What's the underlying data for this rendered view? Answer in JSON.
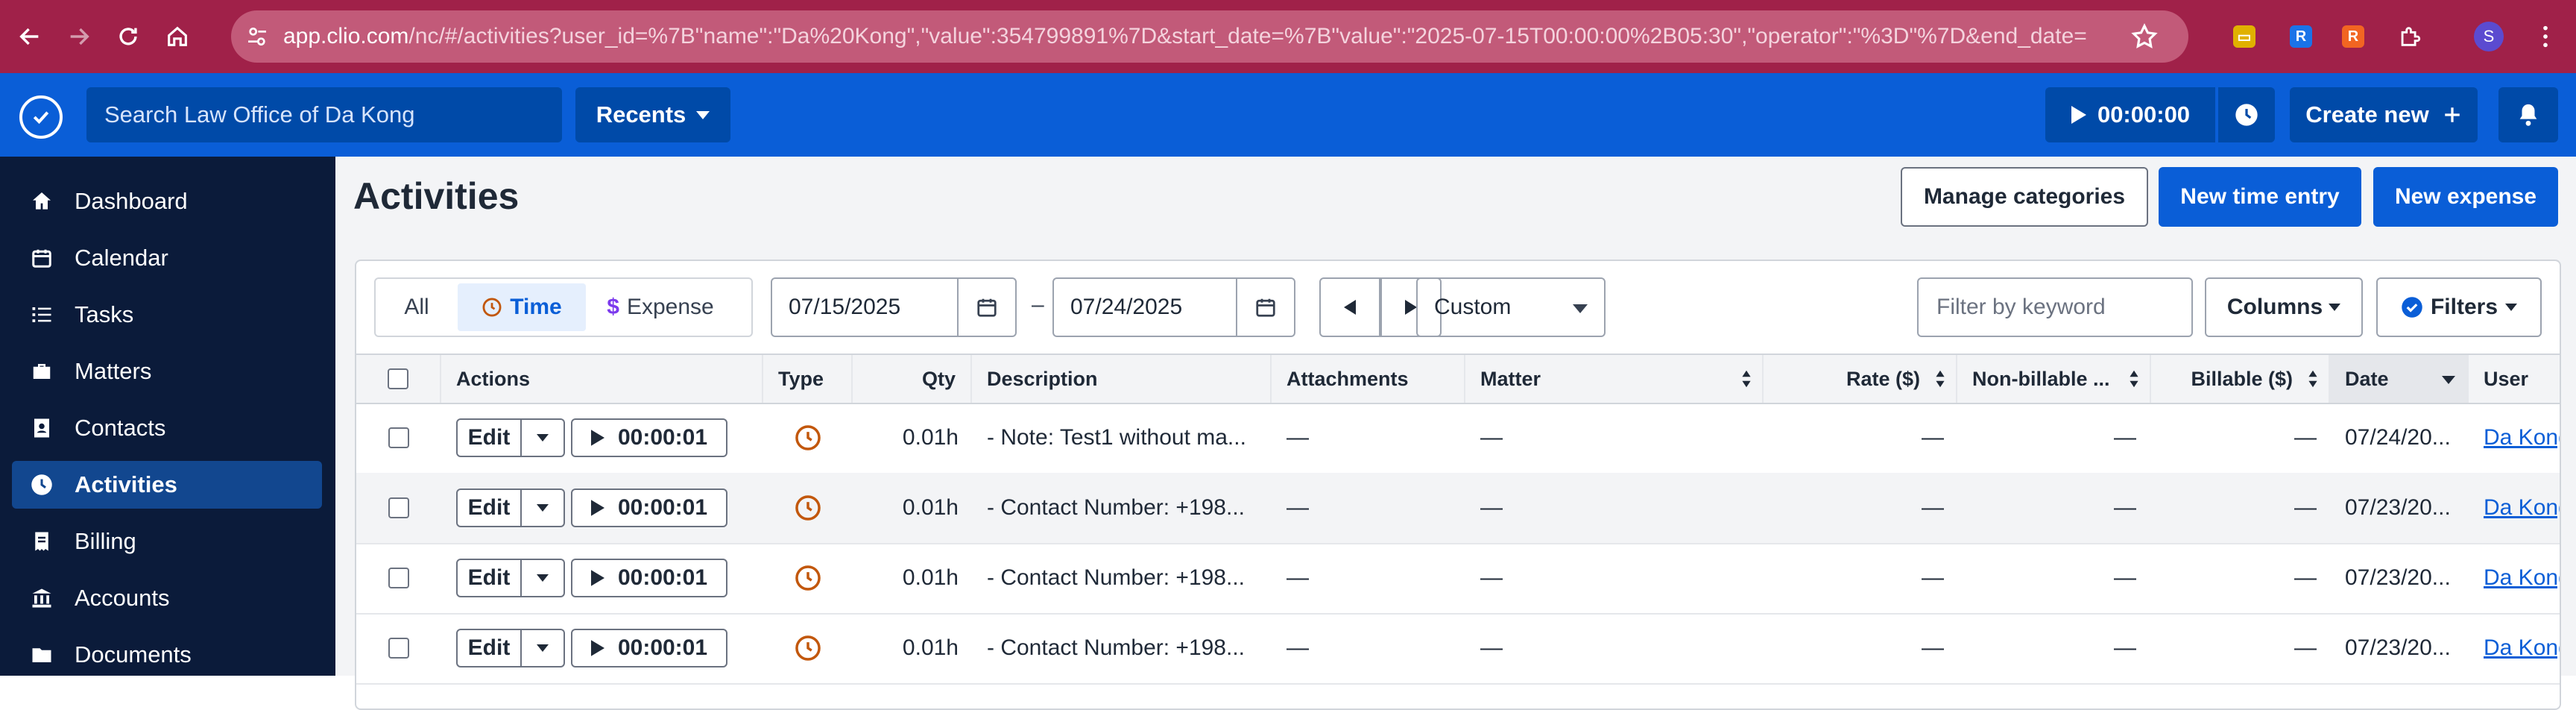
{
  "browser": {
    "url_domain": "app.clio.com",
    "url_rest": "/nc/#/activities?user_id=%7B\"name\":\"Da%20Kong\",\"value\":354799891%7D&start_date=%7B\"value\":\"2025-07-15T00:00:00%2B05:30\",\"operator\":\"%3D\"%7D&end_date=...",
    "profile_initial": "S"
  },
  "header": {
    "search_placeholder": "Search Law Office of Da Kong",
    "recents_label": "Recents",
    "timer_value": "00:00:00",
    "create_new_label": "Create new"
  },
  "sidebar": {
    "items": [
      {
        "label": "Dashboard",
        "icon": "home-icon"
      },
      {
        "label": "Calendar",
        "icon": "calendar-icon"
      },
      {
        "label": "Tasks",
        "icon": "list-icon"
      },
      {
        "label": "Matters",
        "icon": "briefcase-icon"
      },
      {
        "label": "Contacts",
        "icon": "contact-card-icon"
      },
      {
        "label": "Activities",
        "icon": "clock-icon",
        "active": true
      },
      {
        "label": "Billing",
        "icon": "billing-icon"
      },
      {
        "label": "Accounts",
        "icon": "bank-icon"
      },
      {
        "label": "Documents",
        "icon": "folder-icon"
      }
    ]
  },
  "page": {
    "title": "Activities",
    "manage_categories_label": "Manage categories",
    "new_time_entry_label": "New time entry",
    "new_expense_label": "New expense"
  },
  "filters": {
    "tabs": [
      "All",
      "Time",
      "Expense"
    ],
    "active_tab": "Time",
    "start_date": "07/15/2025",
    "range_sep": "–",
    "end_date": "07/24/2025",
    "range_type": "Custom",
    "keyword_placeholder": "Filter by keyword",
    "columns_label": "Columns",
    "filters_label": "Filters"
  },
  "table": {
    "headers": {
      "actions": "Actions",
      "type": "Type",
      "qty": "Qty",
      "description": "Description",
      "attachments": "Attachments",
      "matter": "Matter",
      "rate": "Rate ($)",
      "nonbillable": "Non-billable ...",
      "billable": "Billable ($)",
      "date": "Date",
      "user": "User"
    },
    "edit_label": "Edit",
    "rows": [
      {
        "timer": "00:00:01",
        "qty": "0.01h",
        "description": "- Note: Test1 without ma...",
        "attachments": "—",
        "matter": "—",
        "rate": "—",
        "nonbillable": "—",
        "billable": "—",
        "date": "07/24/20...",
        "user": "Da Kong"
      },
      {
        "timer": "00:00:01",
        "qty": "0.01h",
        "description": "- Contact Number: +198...",
        "attachments": "—",
        "matter": "—",
        "rate": "—",
        "nonbillable": "—",
        "billable": "—",
        "date": "07/23/20...",
        "user": "Da Kong"
      },
      {
        "timer": "00:00:01",
        "qty": "0.01h",
        "description": "- Contact Number: +198...",
        "attachments": "—",
        "matter": "—",
        "rate": "—",
        "nonbillable": "—",
        "billable": "—",
        "date": "07/23/20...",
        "user": "Da Kong"
      },
      {
        "timer": "00:00:01",
        "qty": "0.01h",
        "description": "- Contact Number: +198...",
        "attachments": "—",
        "matter": "—",
        "rate": "—",
        "nonbillable": "—",
        "billable": "—",
        "date": "07/23/20...",
        "user": "Da Kong"
      }
    ]
  },
  "colors": {
    "browser_bar": "#a02149",
    "app_header": "#0a5ed7",
    "sidebar": "#0b1b3a",
    "accent": "#0a5ed7",
    "time_icon": "#c2570c"
  }
}
